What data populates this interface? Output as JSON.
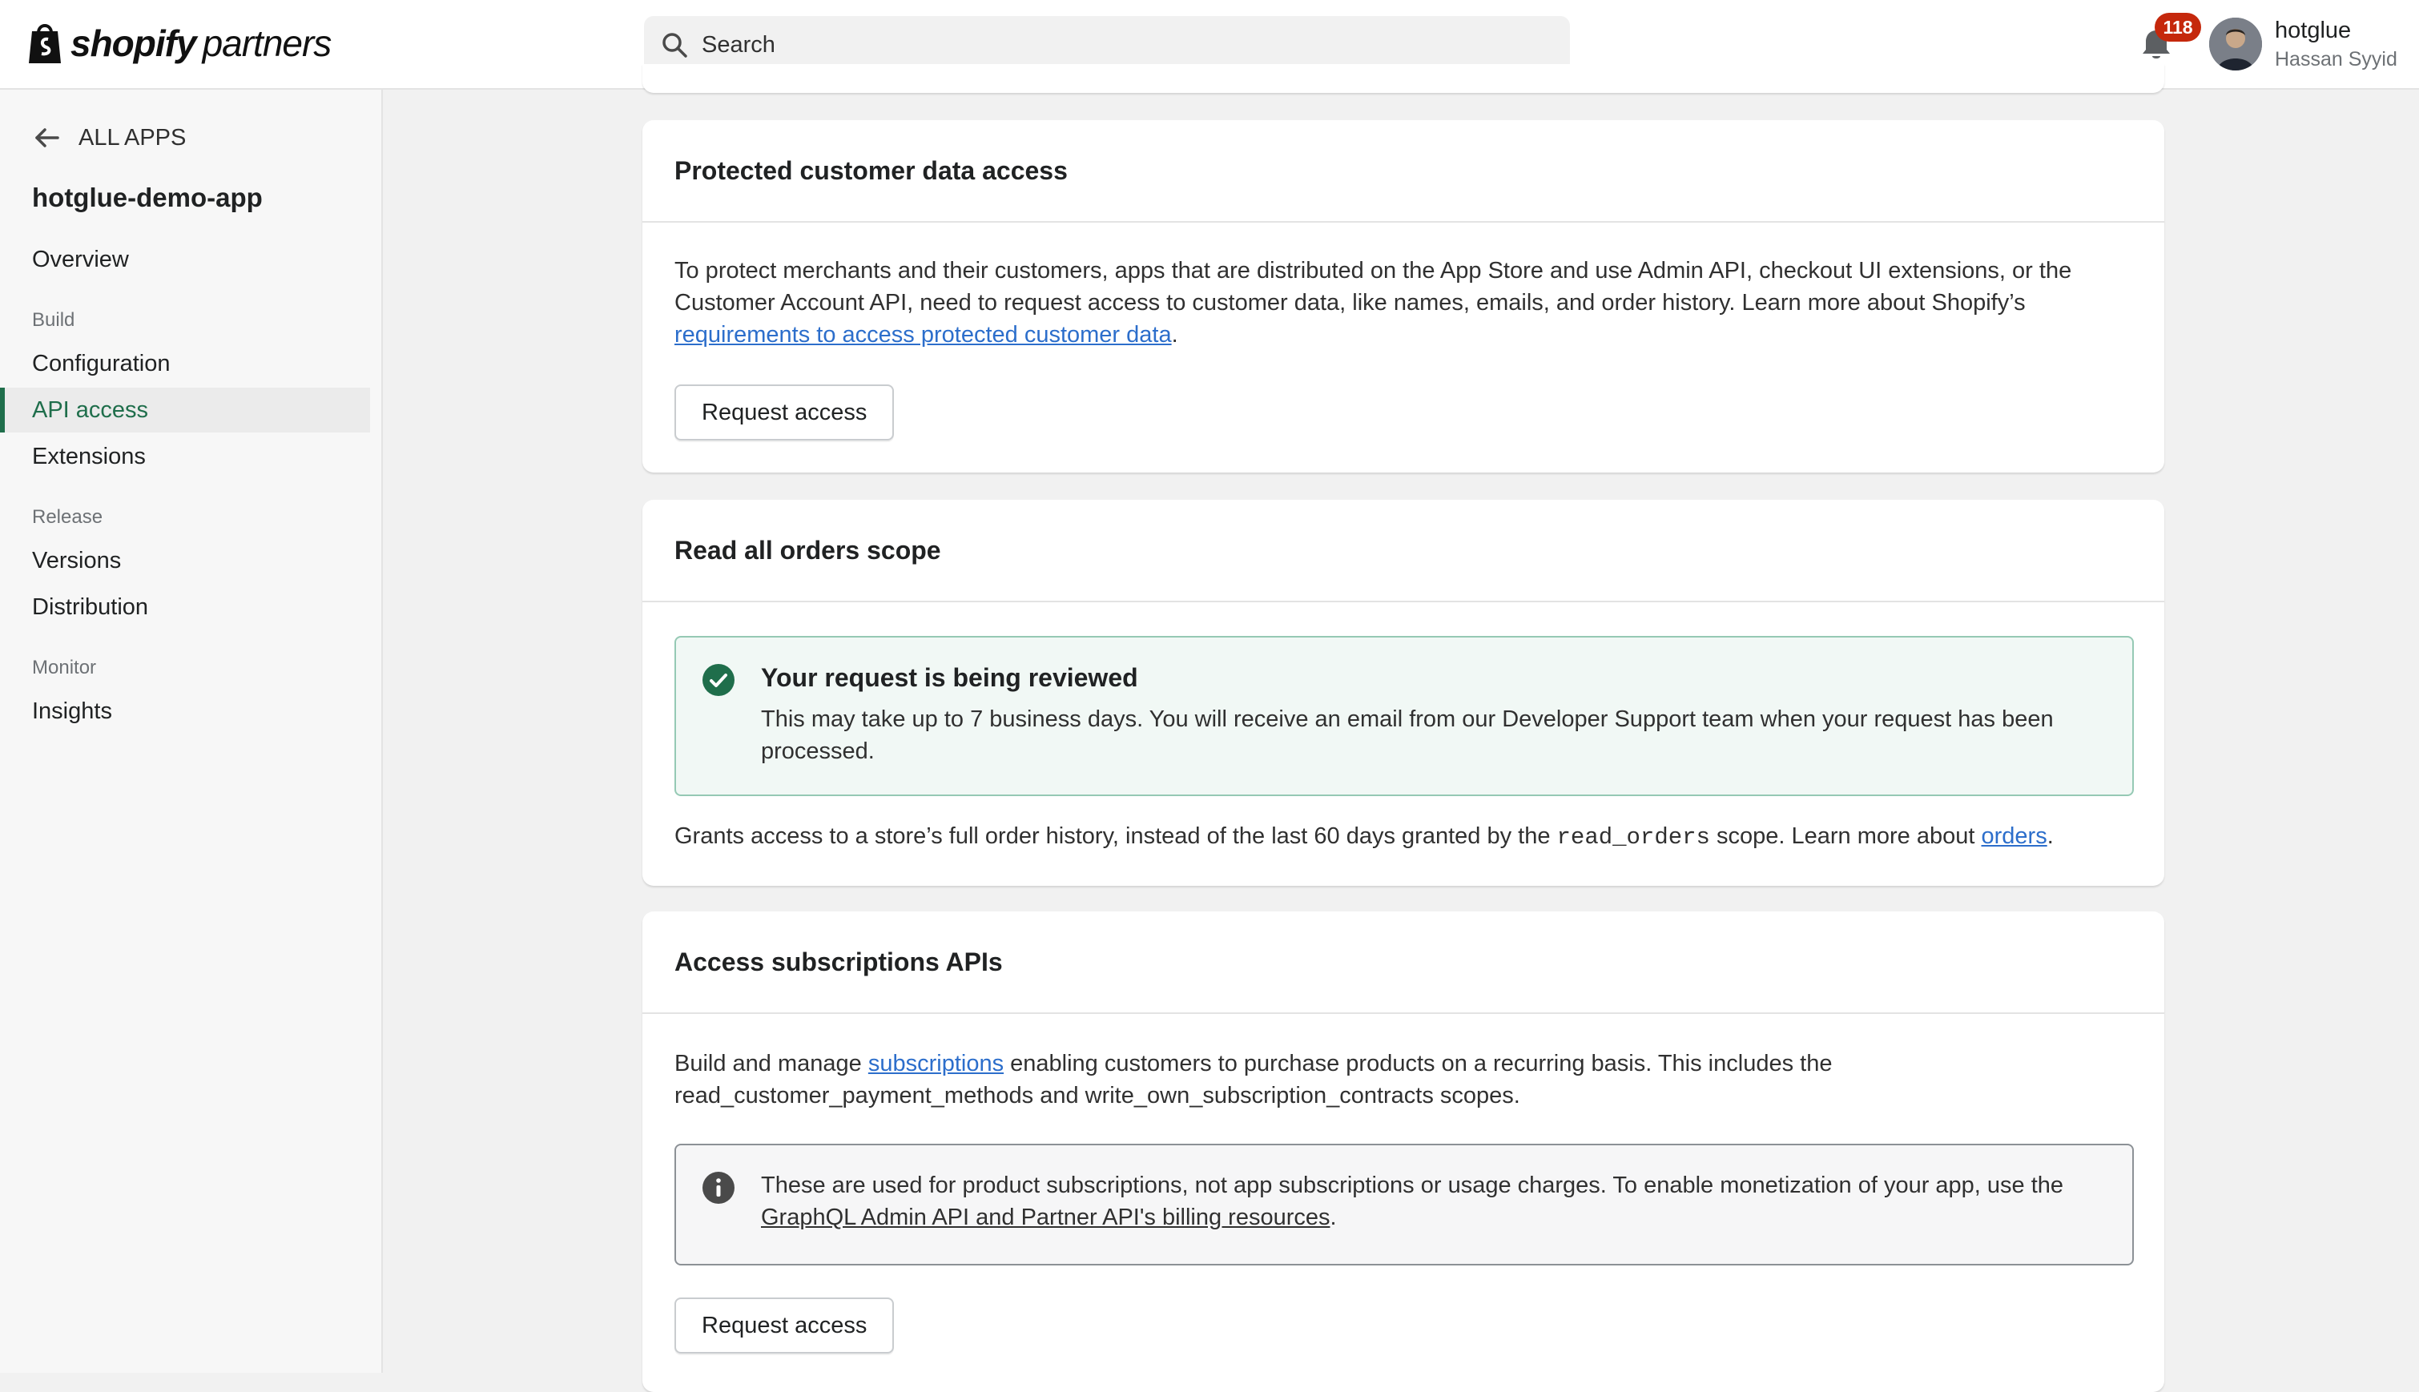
{
  "header": {
    "brand": "shopify",
    "brand_sub": "partners",
    "search_placeholder": "Search",
    "notification_count": "118",
    "user_name": "hotglue",
    "user_subtitle": "Hassan Syyid"
  },
  "sidebar": {
    "back_label": "ALL APPS",
    "app_name": "hotglue-demo-app",
    "overview": "Overview",
    "section_build": "Build",
    "configuration": "Configuration",
    "api_access": "API access",
    "extensions": "Extensions",
    "section_release": "Release",
    "versions": "Versions",
    "distribution": "Distribution",
    "section_monitor": "Monitor",
    "insights": "Insights"
  },
  "protected": {
    "title": "Protected customer data access",
    "text_line1": "To protect merchants and their customers, apps that are distributed on the App Store and use Admin API, checkout UI extensions, or the",
    "text_line2": "Customer Account API, need to request access to customer data, like names, emails, and order history. Learn more about Shopify’s",
    "link": "requirements to access protected customer data",
    "period": ".",
    "button": "Request access"
  },
  "orders_scope": {
    "title": "Read all orders scope",
    "banner_title": "Your request is being reviewed",
    "banner_line1": "This may take up to 7 business days. You will receive an email from our Developer Support team when your request has been",
    "banner_line2": "processed.",
    "text_before": "Grants access to a store’s full order history, instead of the last 60 days granted by the ",
    "code": "read_orders",
    "text_after": " scope. Learn more about ",
    "link": "orders",
    "period": "."
  },
  "subscriptions": {
    "title": "Access subscriptions APIs",
    "text_before": "Build and manage ",
    "link": "subscriptions",
    "text_after": " enabling customers to purchase products on a recurring basis. This includes the",
    "text_line2": "read_customer_payment_methods and write_own_subscription_contracts scopes.",
    "info_line1": "These are used for product subscriptions, not app subscriptions or usage charges. To enable monetization of your app, use the",
    "info_link": "GraphQL Admin API and Partner API's billing resources",
    "info_period": ".",
    "button": "Request access"
  },
  "colors": {
    "accent": "#1f6e4b",
    "link": "#2c6ecb",
    "badge": "#c5280c",
    "success_bg": "#f1f8f5",
    "success_border": "#95c9b4"
  },
  "icons": {
    "search": "search-icon",
    "bell": "bell-icon",
    "back": "arrow-left-icon",
    "success": "check-circle-icon",
    "info": "info-icon"
  }
}
